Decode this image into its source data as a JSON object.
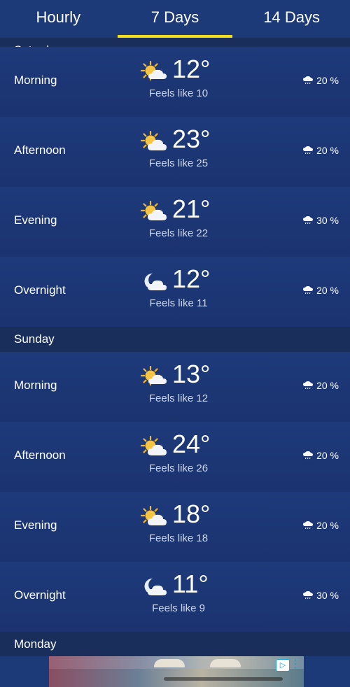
{
  "tabs": [
    {
      "label": "Hourly"
    },
    {
      "label": "7 Days"
    },
    {
      "label": "14 Days"
    }
  ],
  "days": [
    {
      "name": "Saturday",
      "periods": [
        {
          "label": "Morning",
          "icon": "sun-cloud-icon",
          "temp": "12°",
          "feels": "Feels like 10",
          "precip": "20 %"
        },
        {
          "label": "Afternoon",
          "icon": "sun-cloud-icon",
          "temp": "23°",
          "feels": "Feels like 25",
          "precip": "20 %"
        },
        {
          "label": "Evening",
          "icon": "sun-cloud-icon",
          "temp": "21°",
          "feels": "Feels like 22",
          "precip": "30 %"
        },
        {
          "label": "Overnight",
          "icon": "moon-cloud-icon",
          "temp": "12°",
          "feels": "Feels like 11",
          "precip": "20 %"
        }
      ]
    },
    {
      "name": "Sunday",
      "periods": [
        {
          "label": "Morning",
          "icon": "sun-cloud-icon",
          "temp": "13°",
          "feels": "Feels like 12",
          "precip": "20 %"
        },
        {
          "label": "Afternoon",
          "icon": "sun-cloud-icon",
          "temp": "24°",
          "feels": "Feels like 26",
          "precip": "20 %"
        },
        {
          "label": "Evening",
          "icon": "sun-cloud-icon",
          "temp": "18°",
          "feels": "Feels like 18",
          "precip": "20 %"
        },
        {
          "label": "Overnight",
          "icon": "moon-cloud-icon",
          "temp": "11°",
          "feels": "Feels like 9",
          "precip": "30 %"
        }
      ]
    },
    {
      "name": "Monday",
      "periods": []
    }
  ],
  "colors": {
    "background": "#1c3572",
    "tab_indicator": "#f0de1a",
    "day_header": "#1a2e5c"
  }
}
